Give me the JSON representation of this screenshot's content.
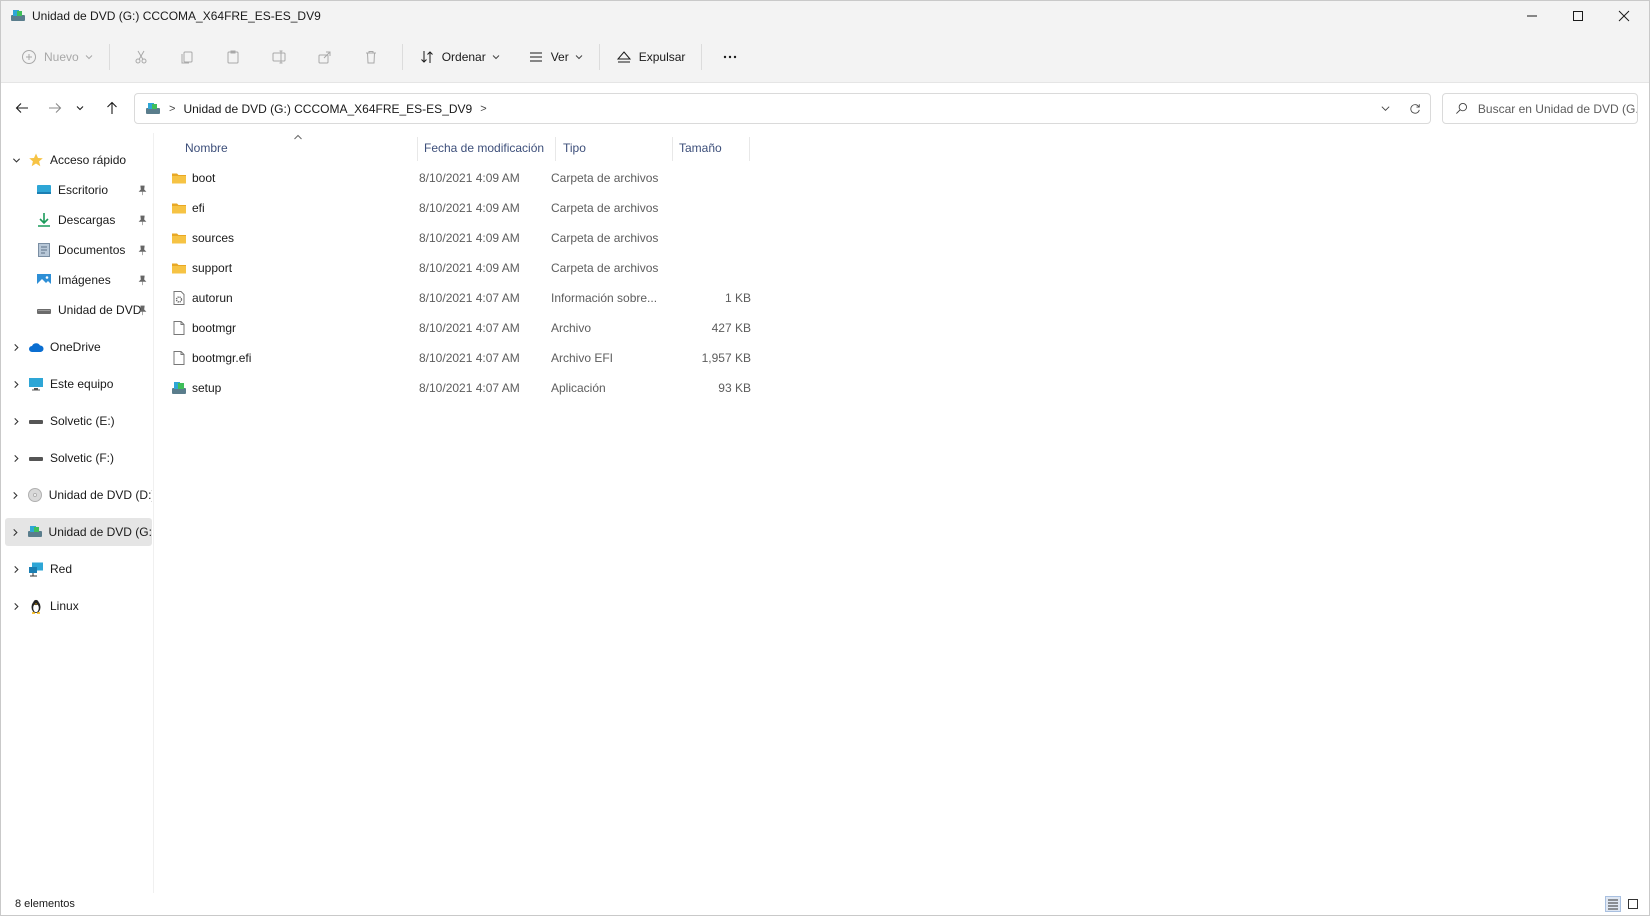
{
  "window": {
    "title": "Unidad de DVD (G:) CCCOMA_X64FRE_ES-ES_DV9"
  },
  "toolbar": {
    "new_label": "Nuevo",
    "sort_label": "Ordenar",
    "view_label": "Ver",
    "eject_label": "Expulsar"
  },
  "address": {
    "path": "Unidad de DVD (G:) CCCOMA_X64FRE_ES-ES_DV9"
  },
  "search": {
    "placeholder": "Buscar en Unidad de DVD (G..."
  },
  "sidebar": {
    "quick_access": "Acceso rápido",
    "pinned": [
      "Escritorio",
      "Descargas",
      "Documentos",
      "Imágenes",
      "Unidad de DVD"
    ],
    "roots": [
      "OneDrive",
      "Este equipo",
      "Solvetic (E:)",
      "Solvetic (F:)",
      "Unidad de DVD (D:)",
      "Unidad de DVD (G:)",
      "Red",
      "Linux"
    ],
    "selected": "Unidad de DVD (G:)"
  },
  "columns": {
    "name": "Nombre",
    "date": "Fecha de modificación",
    "type": "Tipo",
    "size": "Tamaño"
  },
  "files": [
    {
      "name": "boot",
      "date": "8/10/2021 4:09 AM",
      "type": "Carpeta de archivos",
      "size": "",
      "icon": "folder-icon"
    },
    {
      "name": "efi",
      "date": "8/10/2021 4:09 AM",
      "type": "Carpeta de archivos",
      "size": "",
      "icon": "folder-icon"
    },
    {
      "name": "sources",
      "date": "8/10/2021 4:09 AM",
      "type": "Carpeta de archivos",
      "size": "",
      "icon": "folder-icon"
    },
    {
      "name": "support",
      "date": "8/10/2021 4:09 AM",
      "type": "Carpeta de archivos",
      "size": "",
      "icon": "folder-icon"
    },
    {
      "name": "autorun",
      "date": "8/10/2021 4:07 AM",
      "type": "Información sobre...",
      "size": "1 KB",
      "icon": "settings-file-icon"
    },
    {
      "name": "bootmgr",
      "date": "8/10/2021 4:07 AM",
      "type": "Archivo",
      "size": "427 KB",
      "icon": "file-icon"
    },
    {
      "name": "bootmgr.efi",
      "date": "8/10/2021 4:07 AM",
      "type": "Archivo EFI",
      "size": "1,957 KB",
      "icon": "file-icon"
    },
    {
      "name": "setup",
      "date": "8/10/2021 4:07 AM",
      "type": "Aplicación",
      "size": "93 KB",
      "icon": "setup-app-icon"
    }
  ],
  "status": {
    "item_count": "8 elementos"
  },
  "colors": {
    "folder": "#f6c344",
    "accent": "#0067c0",
    "header_text": "#3d4f7a",
    "chrome_bg": "#f3f3f3"
  }
}
